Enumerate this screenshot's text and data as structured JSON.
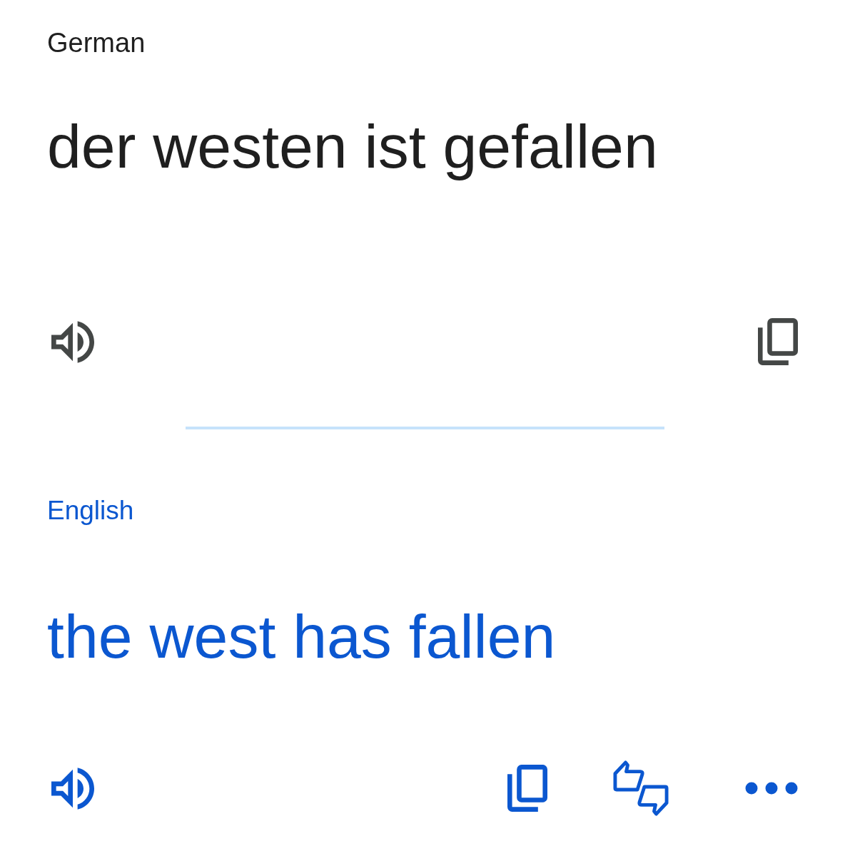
{
  "source": {
    "language": "German",
    "text": "der westen ist gefallen"
  },
  "translation": {
    "language": "English",
    "text": "the west has fallen"
  }
}
